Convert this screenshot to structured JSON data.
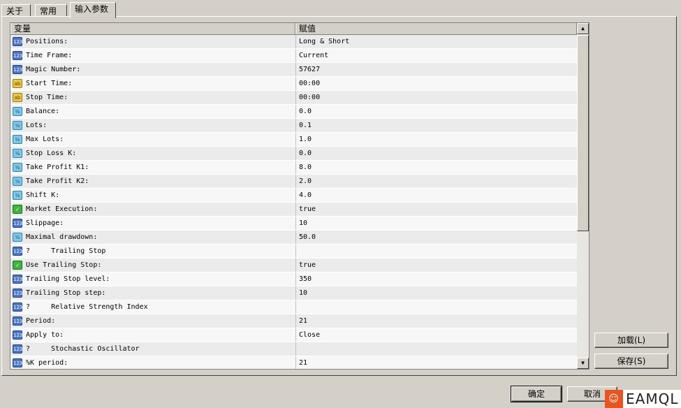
{
  "tabs": [
    {
      "label": "关于",
      "active": false
    },
    {
      "label": "常用",
      "active": false
    },
    {
      "label": "输入参数",
      "active": true
    }
  ],
  "grid": {
    "headers": {
      "variable": "变量",
      "value": "赋值"
    },
    "rows": [
      {
        "icon": "int-icon",
        "name": "Positions:",
        "value": "Long & Short"
      },
      {
        "icon": "int-icon",
        "name": "Time Frame:",
        "value": "Current"
      },
      {
        "icon": "int-icon",
        "name": "Magic Number:",
        "value": "57627"
      },
      {
        "icon": "string-icon",
        "name": "Start Time:",
        "value": "00:00"
      },
      {
        "icon": "string-icon",
        "name": "Stop Time:",
        "value": "00:00"
      },
      {
        "icon": "double-icon",
        "name": "Balance:",
        "value": "0.0"
      },
      {
        "icon": "double-icon",
        "name": "Lots:",
        "value": "0.1"
      },
      {
        "icon": "double-icon",
        "name": "Max Lots:",
        "value": "1.0"
      },
      {
        "icon": "double-icon",
        "name": "Stop Loss K:",
        "value": "0.0"
      },
      {
        "icon": "double-icon",
        "name": "Take Profit K1:",
        "value": "8.0"
      },
      {
        "icon": "double-icon",
        "name": "Take Profit K2:",
        "value": "2.0"
      },
      {
        "icon": "double-icon",
        "name": "Shift K:",
        "value": "4.0"
      },
      {
        "icon": "bool-icon",
        "name": "Market Execution:",
        "value": "true"
      },
      {
        "icon": "int-icon",
        "name": "Slippage:",
        "value": "10"
      },
      {
        "icon": "double-icon",
        "name": "Maximal drawdown:",
        "value": "50.0"
      },
      {
        "icon": "int-icon",
        "name": "?     Trailing Stop",
        "value": ""
      },
      {
        "icon": "bool-icon",
        "name": "Use Trailing Stop:",
        "value": "true"
      },
      {
        "icon": "int-icon",
        "name": "Trailing Stop level:",
        "value": "350"
      },
      {
        "icon": "int-icon",
        "name": "Trailing Stop step:",
        "value": "10"
      },
      {
        "icon": "int-icon",
        "name": "?     Relative Strength Index",
        "value": ""
      },
      {
        "icon": "int-icon",
        "name": "Period:",
        "value": "21"
      },
      {
        "icon": "int-icon",
        "name": "Apply to:",
        "value": "Close"
      },
      {
        "icon": "int-icon",
        "name": "?     Stochastic Oscillator",
        "value": ""
      },
      {
        "icon": "int-icon",
        "name": "%K period:",
        "value": "21"
      }
    ]
  },
  "side_buttons": {
    "load": "加载(L)",
    "save": "保存(S)"
  },
  "bottom_buttons": {
    "ok": "确定",
    "cancel": "取消"
  },
  "watermark": {
    "text": "EAMQL"
  }
}
